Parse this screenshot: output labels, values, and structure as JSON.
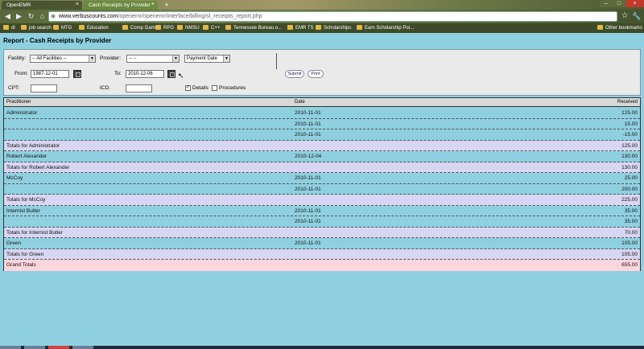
{
  "browser": {
    "tabs": [
      {
        "label": "OpenEMR"
      },
      {
        "label": "Cash Receipts by Provider"
      }
    ],
    "url_domain": "www.verbuscounts.com",
    "url_rest": "/openemr/openemr/interface/billing/sl_receipts_report.php",
    "bookmarks": [
      "dl",
      "job search",
      "MTG",
      "Education",
      "Comp Game",
      "RPG",
      "NMSU",
      "C++",
      "Tennessee Bureau o...",
      "EMR TS",
      "Scholarships",
      "Earn Scholarship Poi..."
    ],
    "other_bookmarks": "Other bookmarks",
    "colors": {
      "tab_active": "#6b8a3e",
      "chrome": "#56683a"
    }
  },
  "report": {
    "title": "Report - Cash Receipts by Provider",
    "filters": {
      "facility_label": "Facility:",
      "facility_value": "-- All Facilities --",
      "provider_label": "Provider:",
      "provider_value": "-- --",
      "date_type_value": "Payment Date",
      "from_label": "From:",
      "from_value": "1987-12-01",
      "to_label": "To:",
      "to_value": "2010-12-06",
      "cpt_label": "CPT:",
      "cpt_value": "",
      "icd_label": "ICD:",
      "icd_value": "",
      "details_label": "Details",
      "details_checked": true,
      "procedures_label": "Procedures",
      "procedures_checked": false,
      "submit_label": "Submit",
      "print_label": "Print"
    },
    "table": {
      "headers": {
        "practitioner": "Practitioner",
        "date": "Date",
        "received": "Received"
      },
      "rows": [
        {
          "type": "detail",
          "practitioner": "Administrator",
          "date": "2010-11-01",
          "amount": "125.00"
        },
        {
          "type": "detail",
          "practitioner": "",
          "date": "2010-11-01",
          "amount": "15.00"
        },
        {
          "type": "detail",
          "practitioner": "",
          "date": "2010-11-01",
          "amount": "-15.00"
        },
        {
          "type": "total",
          "practitioner": "Totals for Administrator",
          "date": "",
          "amount": "125.00"
        },
        {
          "type": "detail",
          "practitioner": "Robert Alexander",
          "date": "2010-12-04",
          "amount": "130.00"
        },
        {
          "type": "total",
          "practitioner": "Totals for Robert Alexander",
          "date": "",
          "amount": "130.00"
        },
        {
          "type": "detail",
          "practitioner": "McCoy",
          "date": "2010-11-01",
          "amount": "25.00"
        },
        {
          "type": "detail",
          "practitioner": "",
          "date": "2010-11-01",
          "amount": "200.00"
        },
        {
          "type": "total",
          "practitioner": "Totals for McCoy",
          "date": "",
          "amount": "225.00"
        },
        {
          "type": "detail",
          "practitioner": "Internist Butler",
          "date": "2010-11-01",
          "amount": "35.00"
        },
        {
          "type": "detail",
          "practitioner": "",
          "date": "2010-11-01",
          "amount": "35.00"
        },
        {
          "type": "total",
          "practitioner": "Totals for Internist Butler",
          "date": "",
          "amount": "70.00"
        },
        {
          "type": "detail",
          "practitioner": "Green",
          "date": "2010-11-01",
          "amount": "105.00"
        },
        {
          "type": "total",
          "practitioner": "Totals for Green",
          "date": "",
          "amount": "105.00"
        },
        {
          "type": "grand",
          "practitioner": "Grand Totals",
          "date": "",
          "amount": "655.00"
        }
      ]
    },
    "colors": {
      "page_bg": "#8fd0e0",
      "total_row": "#d8d6f2",
      "grand_row": "#fcd6dc",
      "header_bg": "#d8d8d8"
    }
  }
}
